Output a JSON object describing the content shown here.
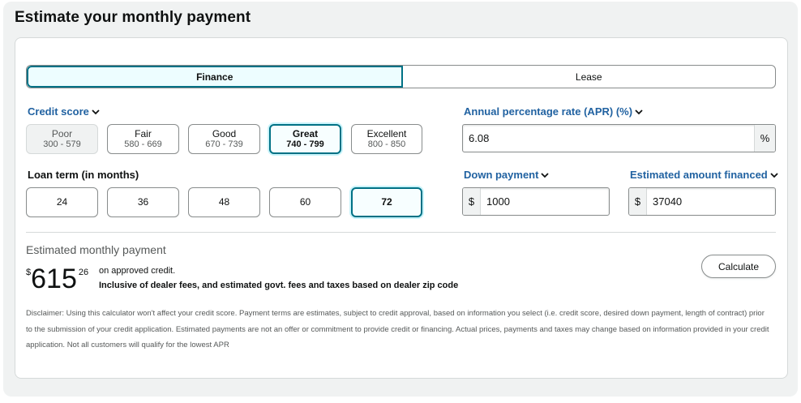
{
  "title": "Estimate your monthly payment",
  "tabs": [
    {
      "label": "Finance",
      "active": true
    },
    {
      "label": "Lease",
      "active": false
    }
  ],
  "credit_score": {
    "label": "Credit score",
    "options": [
      {
        "label": "Poor",
        "range": "300 - 579",
        "state": "disabled"
      },
      {
        "label": "Fair",
        "range": "580 - 669",
        "state": "normal"
      },
      {
        "label": "Good",
        "range": "670 - 739",
        "state": "normal"
      },
      {
        "label": "Great",
        "range": "740 - 799",
        "state": "selected"
      },
      {
        "label": "Excellent",
        "range": "800 - 850",
        "state": "normal"
      }
    ]
  },
  "loan_term": {
    "label": "Loan term (in months)",
    "options": [
      {
        "label": "24",
        "selected": false
      },
      {
        "label": "36",
        "selected": false
      },
      {
        "label": "48",
        "selected": false
      },
      {
        "label": "60",
        "selected": false
      },
      {
        "label": "72",
        "selected": true
      }
    ]
  },
  "apr": {
    "label": "Annual percentage rate (APR) (%)",
    "value": "6.08",
    "suffix": "%"
  },
  "down_payment": {
    "label": "Down payment",
    "prefix": "$",
    "value": "1000"
  },
  "amount_financed": {
    "label": "Estimated amount financed",
    "prefix": "$",
    "value": "37040"
  },
  "estimate": {
    "label": "Estimated monthly payment",
    "currency": "$",
    "whole": "615",
    "fraction": "26",
    "approved_text": "on approved credit.",
    "inclusive_text": "Inclusive of dealer fees, and estimated govt. fees and taxes based on dealer zip code"
  },
  "calculate_label": "Calculate",
  "disclaimer": "Disclaimer: Using this calculator won't affect your credit score. Payment terms are estimates, subject to credit approval, based on information you select (i.e. credit score, desired down payment, length of contract) prior to the submission of your credit application. Estimated payments are not an offer or commitment to provide credit or financing. Actual prices, payments and taxes may change based on information provided in your credit application. Not all customers will qualify for the lowest APR",
  "colors": {
    "link": "#2162a1",
    "accent": "#007185",
    "background": "#f0f2f2"
  }
}
